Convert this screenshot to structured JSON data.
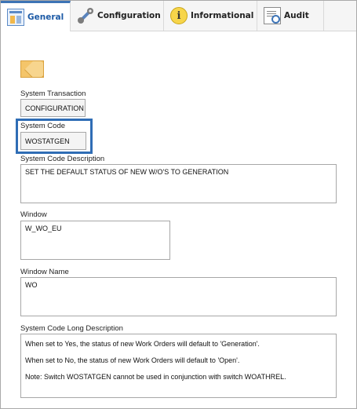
{
  "tabs": [
    {
      "label": "General",
      "icon": "general-form-icon",
      "active": true
    },
    {
      "label": "Configuration",
      "icon": "wrench-icon",
      "active": false
    },
    {
      "label": "Informational",
      "icon": "info-icon",
      "active": false
    },
    {
      "label": "Audit",
      "icon": "audit-document-icon",
      "active": false
    }
  ],
  "form": {
    "system_transaction_label": "System Transaction",
    "system_transaction_value": "CONFIGURATION",
    "system_code_label": "System Code",
    "system_code_value": "WOSTATGEN",
    "description_label": "System Code Description",
    "description_value": "SET THE DEFAULT STATUS OF NEW W/O'S TO GENERATION",
    "window_label": "Window",
    "window_value": "W_WO_EU",
    "window_name_label": "Window Name",
    "window_name_value": "WO",
    "long_description_label": "System Code Long Description",
    "long_description_lines": [
      "When set to Yes, the status of new Work Orders will default to 'Generation'.",
      "When set to No, the status of new Work Orders will default to 'Open'.",
      "Note: Switch WOSTATGEN cannot be used in conjunction with switch WOATHREL."
    ]
  },
  "colors": {
    "accent": "#2f6db5",
    "tab_active": "#1c5aa6"
  }
}
